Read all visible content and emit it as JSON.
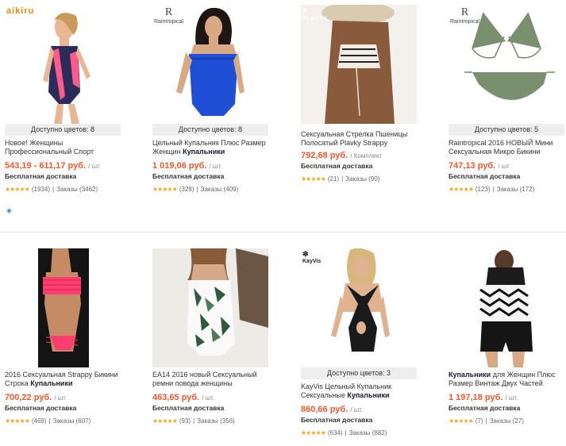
{
  "products": [
    {
      "brand": "aikiru",
      "colors_label": "Доступно цветов: 8",
      "title": "Новое! Женщины Профессиональный Спорт",
      "title_bold": "",
      "price": "543,19 - 611,17 руб.",
      "unit": "/ шт.",
      "shipping": "Бесплатная доставка",
      "reviews": "(1934)",
      "orders": "Заказы (3462)"
    },
    {
      "brand": "Raintropical",
      "colors_label": "Доступно цветов: 8",
      "title": "Цельный Купальник Плюс Размер Женщин ",
      "title_bold": "Купальники",
      "price": "1 019,06 руб.",
      "unit": "/ шт.",
      "shipping": "Бесплатная доставка",
      "reviews": "(328)",
      "orders": "Заказы (409)"
    },
    {
      "brand": "PLAVKY",
      "colors_label": "",
      "title": "Сексуальная Стрелка Пшеницы Полосатый Plavky Strappy",
      "title_bold": "",
      "price": "792,68 руб.",
      "unit": "/ Комплект",
      "shipping": "Бесплатная доставка",
      "reviews": "(21)",
      "orders": "Заказы (90)"
    },
    {
      "brand": "Raintropical",
      "colors_label": "Доступно цветов: 5",
      "title": "Raintropical 2016 НОВЫЙ Мини Сексуальная Микро Бикини",
      "title_bold": "",
      "price": "747,13 руб.",
      "unit": "/ шт.",
      "shipping": "Бесплатная доставка",
      "reviews": "(123)",
      "orders": "Заказы (172)"
    },
    {
      "brand": "",
      "colors_label": "",
      "title": "2016 Сексуальная Strappy Бикини Строка ",
      "title_bold": "Купальники",
      "price": "700,22 руб.",
      "unit": "/ шт.",
      "shipping": "Бесплатная доставка",
      "reviews": "(469)",
      "orders": "Заказы (607)"
    },
    {
      "brand": "",
      "colors_label": "",
      "title": "EA14 2016 новый Сексуальный ремни повода женщины",
      "title_bold": "",
      "price": "463,65 руб.",
      "unit": "/ шт.",
      "shipping": "Бесплатная доставка",
      "reviews": "(93)",
      "orders": "Заказы (356)"
    },
    {
      "brand": "KayVis",
      "colors_label": "Доступно цветов: 3",
      "title": "KayVis Цельный Купальник Сексуальные ",
      "title_bold": "Купальники",
      "price": "860,66 руб.",
      "unit": "/ шт.",
      "shipping": "Бесплатная доставка",
      "reviews": "(634)",
      "orders": "Заказы (882)"
    },
    {
      "brand": "",
      "colors_label": "",
      "title": "",
      "title_bold_first": "Купальники",
      "title_rest": " для Женщин Плюс Размер Винтаж Двух Частей",
      "price": "1 197,18 руб.",
      "unit": "/ шт.",
      "shipping": "Бесплатная доставка",
      "reviews": "(7)",
      "orders": "Заказы (27)"
    }
  ],
  "stars": "★★★★★",
  "separator": "|",
  "icons": {
    "rating": "star-icon",
    "extra": "discount-icon"
  },
  "colors": {
    "price": "#f5582c",
    "stars": "#f5a623",
    "brand_aikiru": "#f28a00"
  }
}
